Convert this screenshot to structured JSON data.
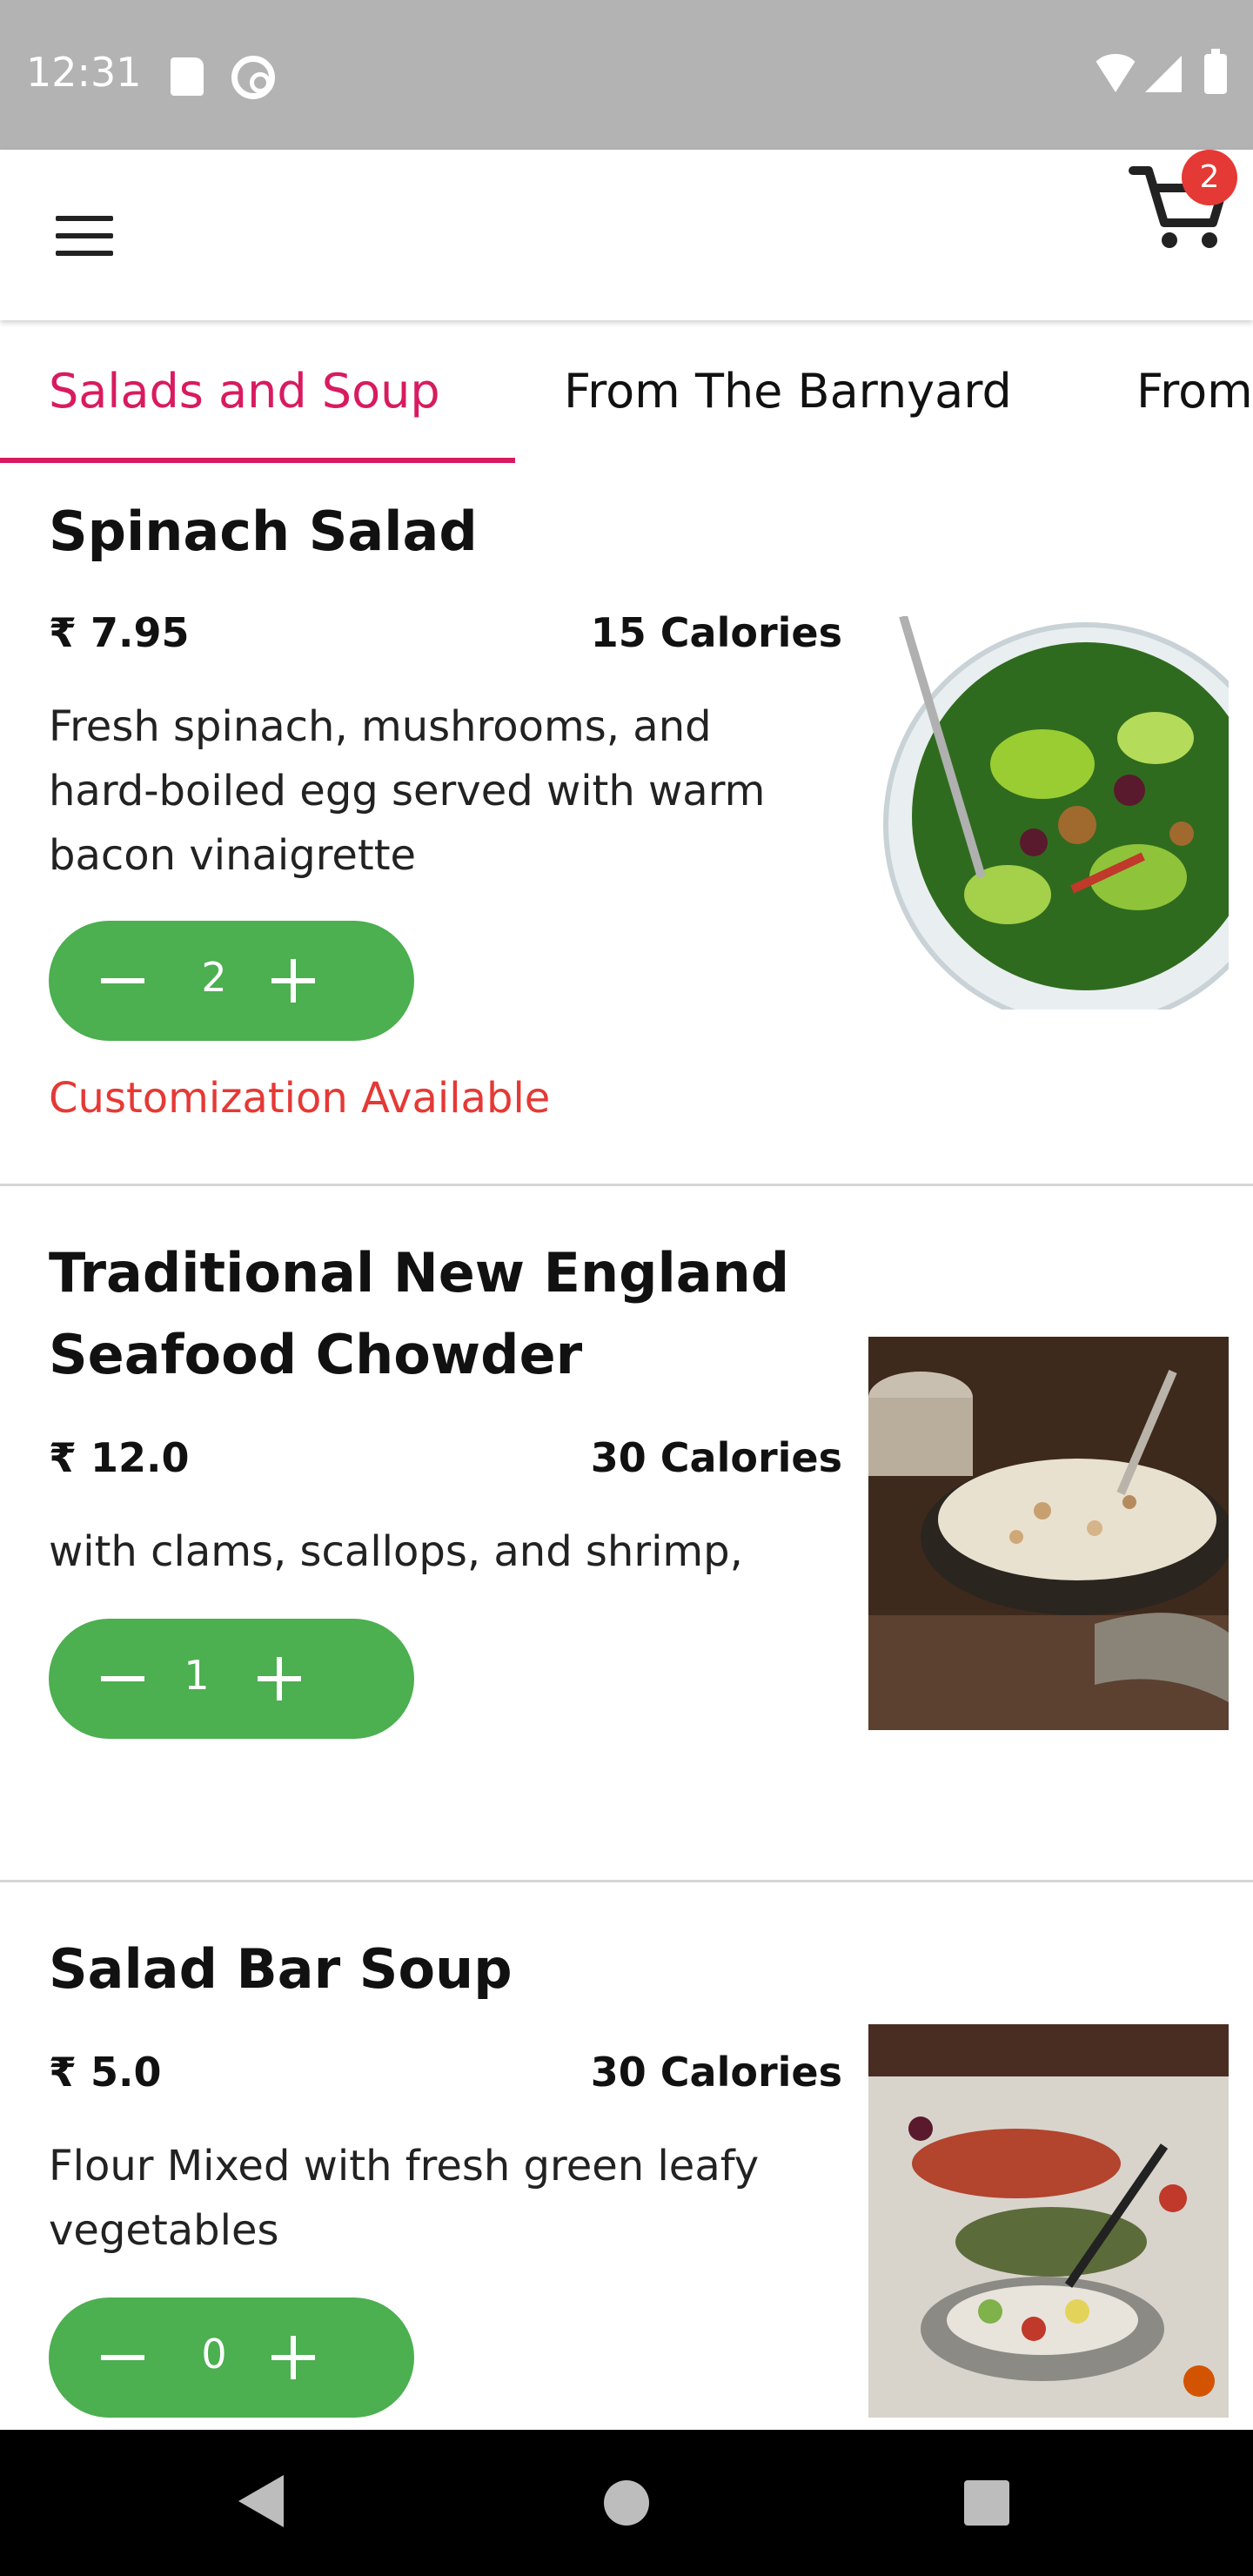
{
  "status_bar": {
    "time": "12:31"
  },
  "header": {
    "cart_count": "2"
  },
  "tabs": [
    {
      "label": "Salads and Soup"
    },
    {
      "label": "From The Barnyard"
    },
    {
      "label": "From"
    }
  ],
  "items": [
    {
      "title": "Spinach Salad",
      "price": "₹ 7.95",
      "calories": "15 Calories",
      "description": "Fresh spinach, mushrooms, and hard-boiled egg served with warm bacon vinaigrette",
      "quantity": "2",
      "customization": "Customization Available"
    },
    {
      "title": "Traditional New England Seafood Chowder",
      "price": "₹ 12.0",
      "calories": "30 Calories",
      "description": "with clams, scallops, and shrimp,",
      "quantity": "1"
    },
    {
      "title": "Salad Bar Soup",
      "price": "₹ 5.0",
      "calories": "30 Calories",
      "description": "Flour Mixed with fresh green leafy vegetables",
      "quantity": "0"
    }
  ],
  "colors": {
    "accent": "#d81b60",
    "stepper": "#4caf50",
    "badge": "#e53935",
    "customization": "#e53935"
  }
}
